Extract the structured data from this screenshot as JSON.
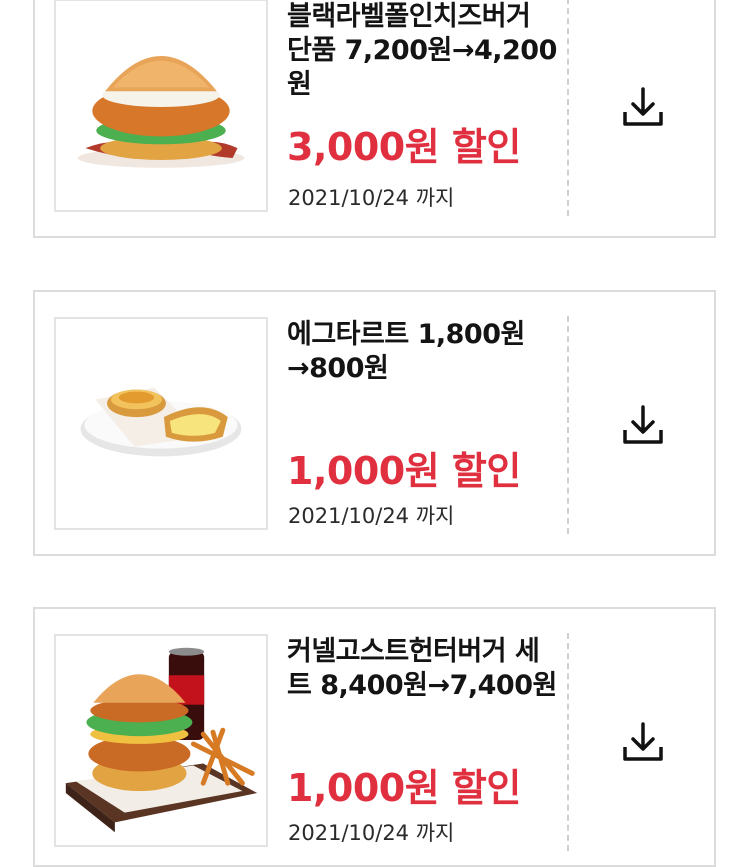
{
  "coupons": [
    {
      "title": "블랙라벨폴인치즈버거 단품 7,200원→4,200원",
      "discount": "3,000원 할인",
      "expiry": "2021/10/24 까지",
      "image": "black-label-cheese-burger",
      "download_icon": "download-icon"
    },
    {
      "title": "에그타르트 1,800원 →800원",
      "discount": "1,000원 할인",
      "expiry": "2021/10/24 까지",
      "image": "egg-tart",
      "download_icon": "download-icon"
    },
    {
      "title": "커넬고스트헌터버거 세트 8,400원→7,400원",
      "discount": "1,000원 할인",
      "expiry": "2021/10/24 까지",
      "image": "colonel-ghost-hunter-burger-set",
      "download_icon": "download-icon"
    }
  ],
  "colors": {
    "discount": "#e0303f",
    "border": "#dcdcdc",
    "text": "#141414"
  }
}
